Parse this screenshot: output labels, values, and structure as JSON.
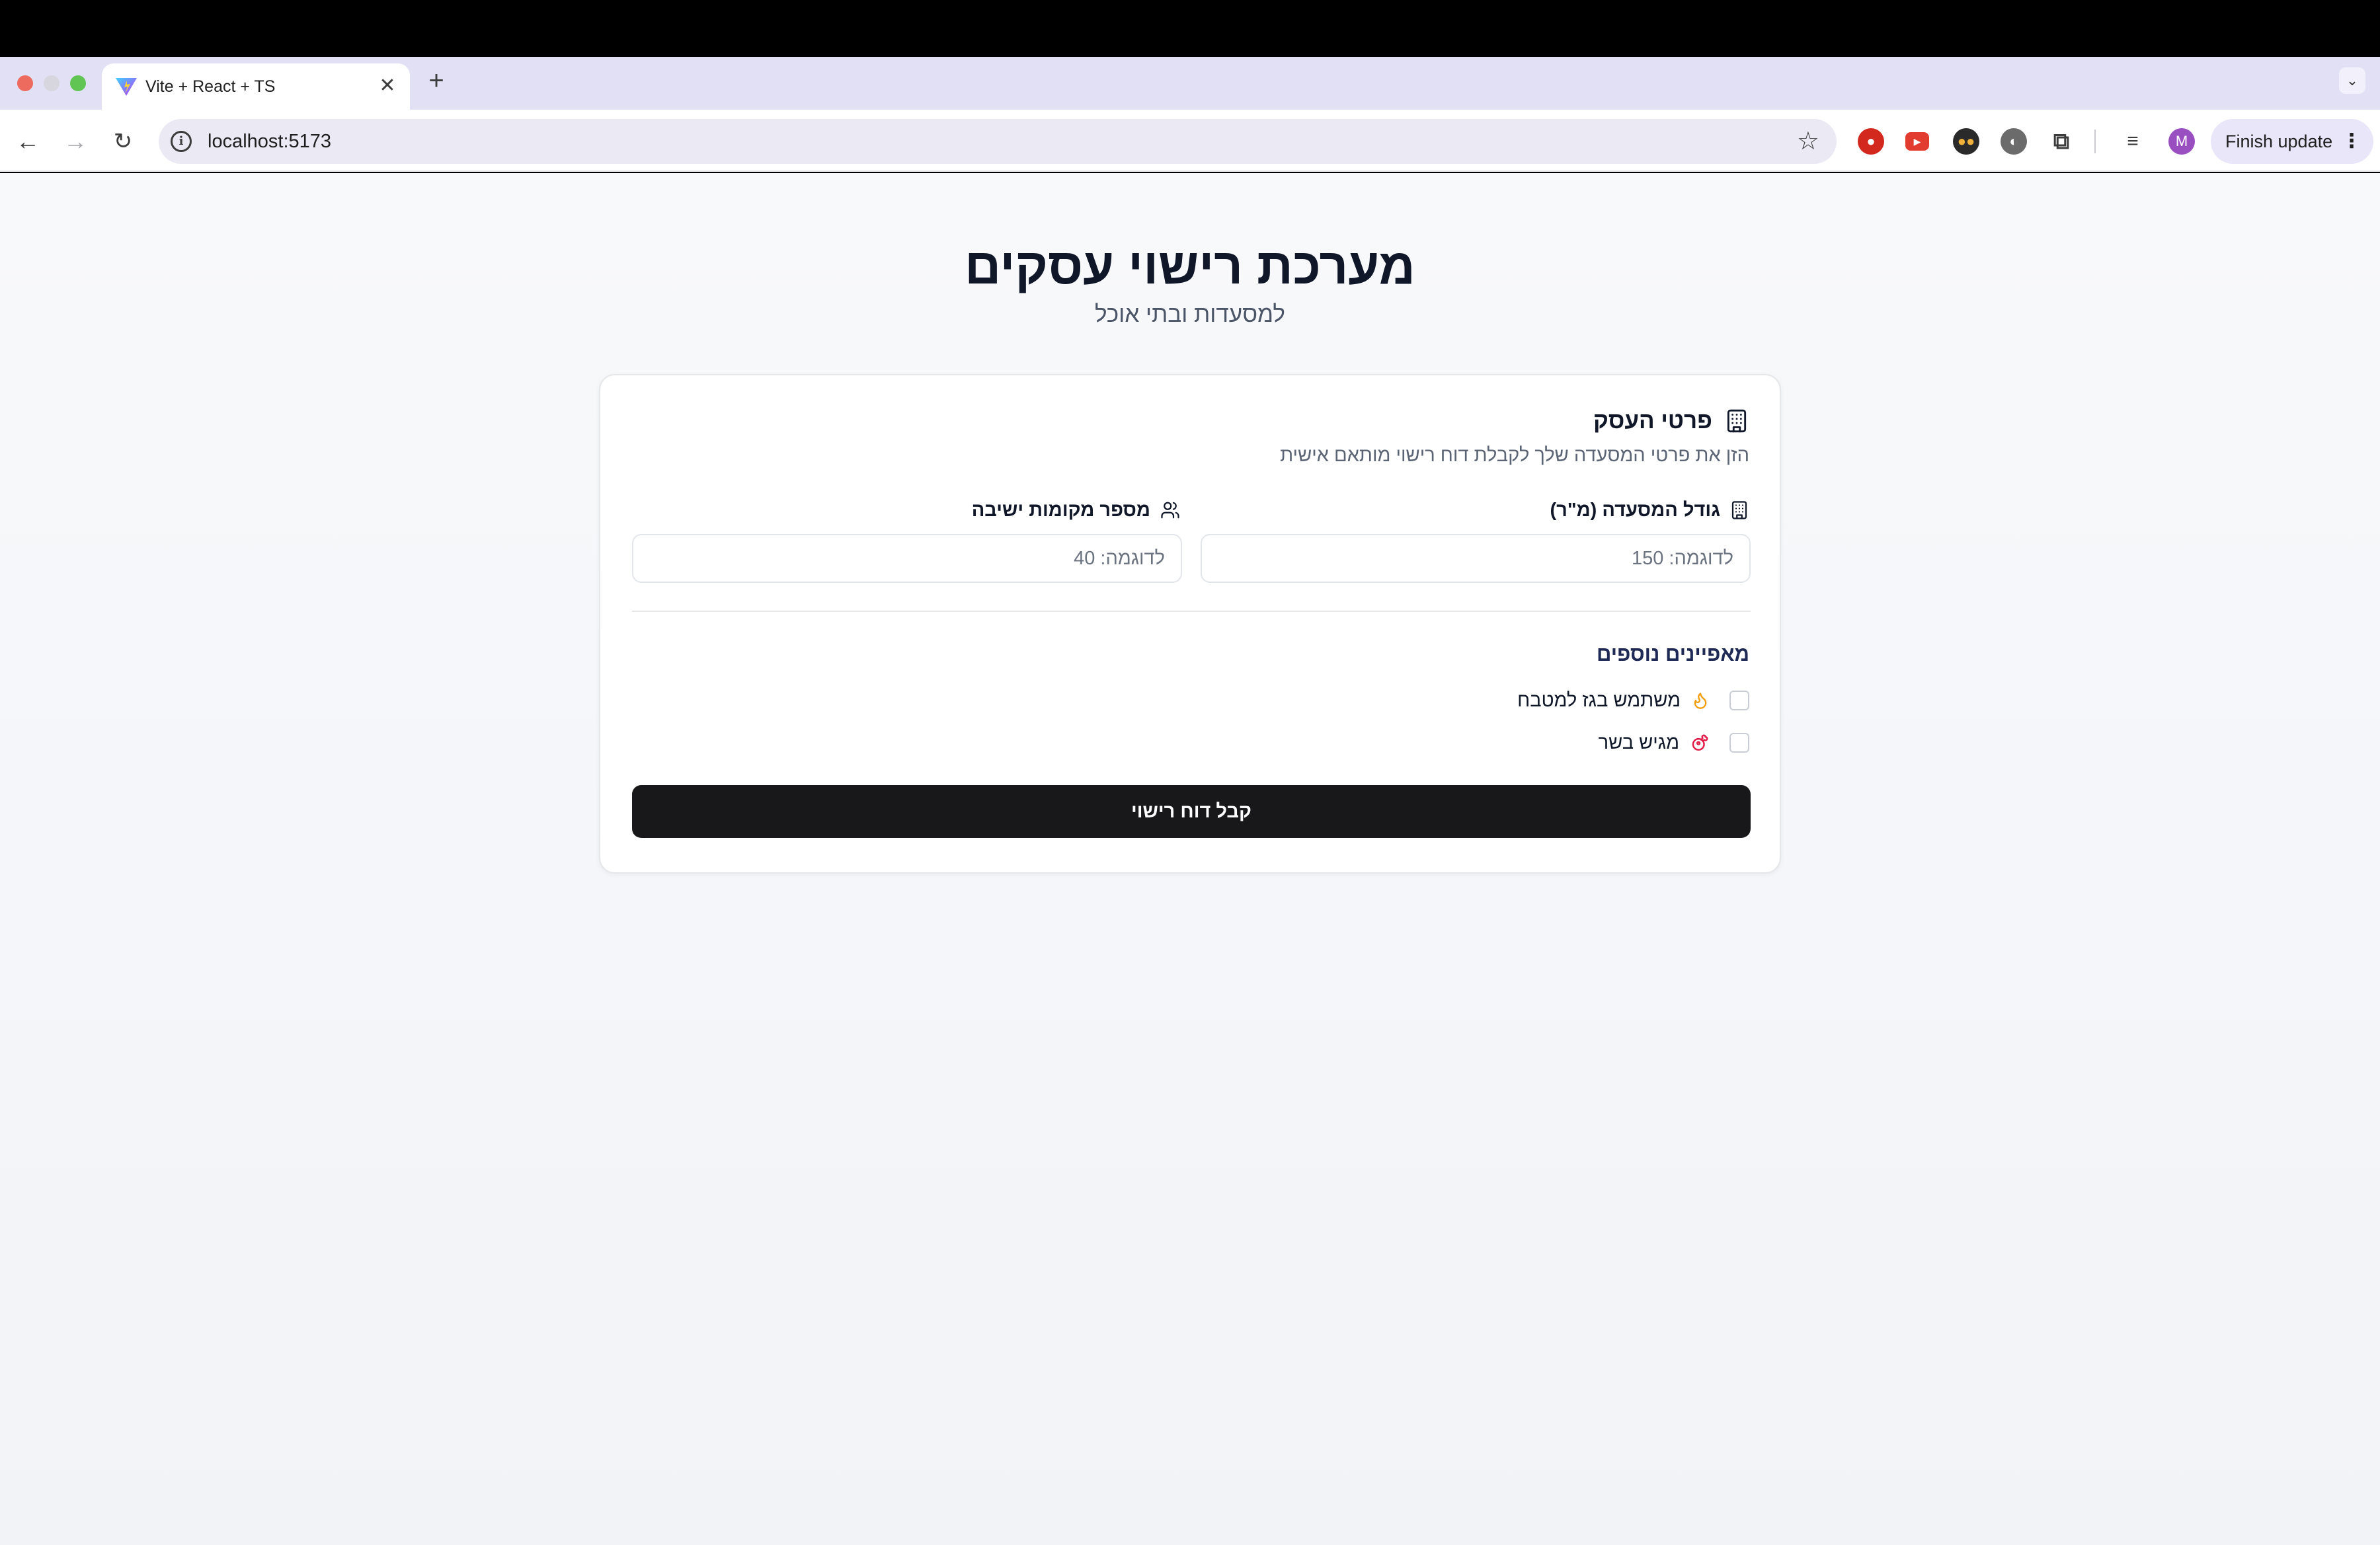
{
  "browser": {
    "tab_title": "Vite + React + TS",
    "new_tab_icon": "plus-icon",
    "url": "localhost:5173",
    "profile_initial": "M",
    "finish_update_label": "Finish update",
    "extensions": [
      "record-extension-icon",
      "youtube-extension-icon",
      "eyes-extension-icon",
      "incognito-extension-icon",
      "puzzle-extensions-icon",
      "media-controls-icon"
    ]
  },
  "page": {
    "title": "מערכת רישוי עסקים",
    "subtitle": "למסעדות ובתי אוכל"
  },
  "card": {
    "title": "פרטי העסק",
    "description": "הזן את פרטי המסעדה שלך לקבלת דוח רישוי מותאם אישית",
    "fields": {
      "size_label": "גודל המסעדה (מ\"ר)",
      "size_placeholder": "לדוגמה: 150",
      "seats_label": "מספר מקומות ישיבה",
      "seats_placeholder": "לדוגמה: 40"
    },
    "features_title": "מאפיינים נוספים",
    "features": [
      {
        "label": "משתמש בגז למטבח",
        "icon": "flame-icon",
        "checked": false
      },
      {
        "label": "מגיש בשר",
        "icon": "meat-icon",
        "checked": false
      }
    ],
    "submit_label": "קבל דוח רישוי"
  },
  "colors": {
    "accent_button": "#18181b",
    "heading": "#0f1729",
    "flame_icon": "#f59e0b",
    "meat_icon": "#e11d48"
  }
}
